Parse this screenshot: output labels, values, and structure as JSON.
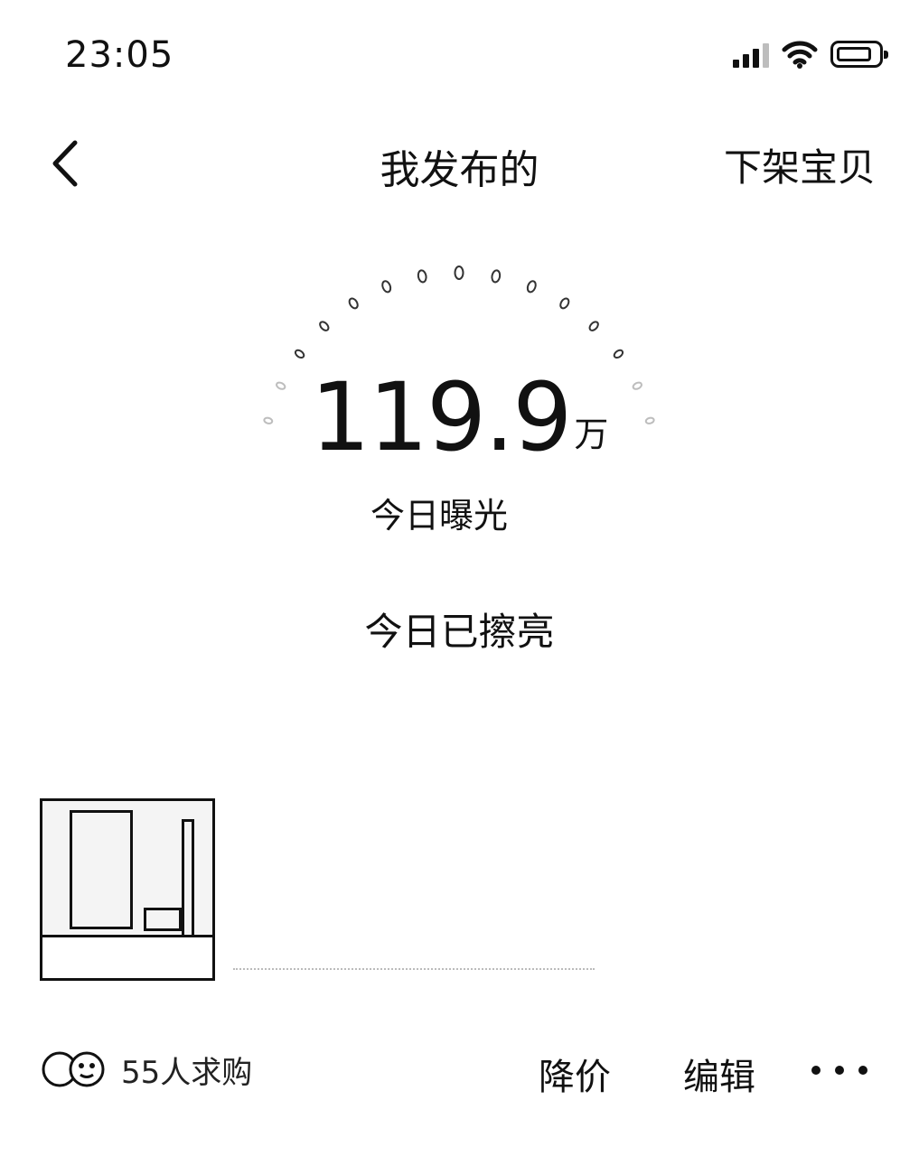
{
  "status_bar": {
    "time": "23:05",
    "icons": [
      "cellular-signal-icon",
      "wifi-icon",
      "battery-icon"
    ]
  },
  "nav": {
    "back_icon": "chevron-left-icon",
    "title": "我发布的",
    "right_action": "下架宝贝"
  },
  "exposure": {
    "value": "119.9",
    "unit": "万",
    "label": "今日曝光"
  },
  "polish": {
    "status": "今日已擦亮"
  },
  "item": {
    "thumbnail_icon": "product-photo",
    "title": "",
    "price": ""
  },
  "footer": {
    "wants_icon": "buyer-avatars-icon",
    "wants_text": "55人求购",
    "price_cut_label": "降价",
    "edit_label": "编辑",
    "more_icon": "more-dots-icon"
  }
}
